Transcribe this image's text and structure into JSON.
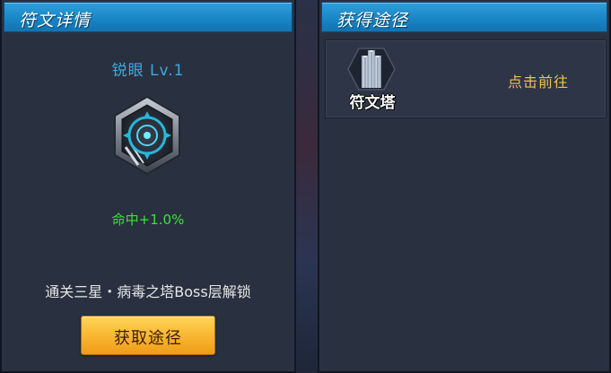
{
  "left_panel": {
    "title": "符文详情",
    "rune_name": "锐眼 Lv.1",
    "rune_icon": "rune-hexagon-icon",
    "stat": "命中+1.0%",
    "unlock_text": "通关三星・病毒之塔Boss层解锁",
    "button_label": "获取途径"
  },
  "right_panel": {
    "title": "获得途径",
    "sources": [
      {
        "name": "符文塔",
        "icon": "tower-icon",
        "action_label": "点击前往"
      }
    ]
  },
  "colors": {
    "header_blue": "#1a86c6",
    "panel_bg": "#2a3142",
    "rune_name": "#3ea8e0",
    "stat_green": "#3be23b",
    "button_orange": "#f9b732",
    "link_gold": "#f0c24a"
  }
}
